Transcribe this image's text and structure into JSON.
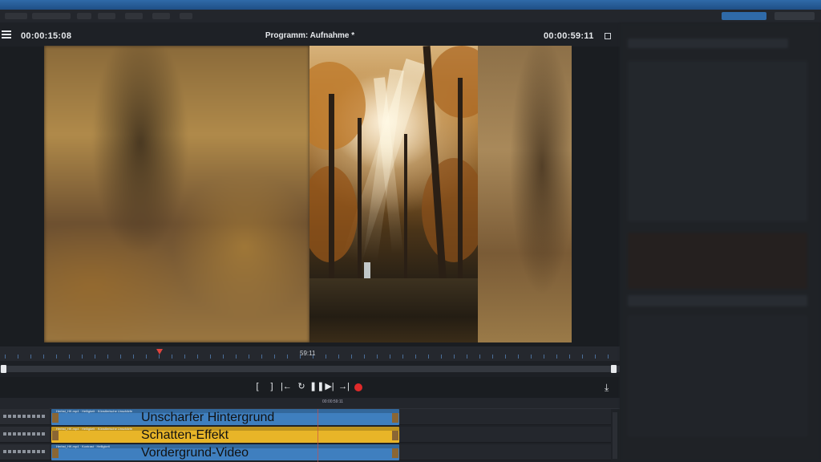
{
  "player": {
    "current_timecode": "00:00:15:08",
    "title": "Programm: Aufnahme *",
    "duration_timecode": "00:00:59:11"
  },
  "scrubber": {
    "ruler_timecode": "59:11"
  },
  "transport": {
    "mark_in": "[",
    "mark_out": "]",
    "go_to_start": "|←",
    "loop": "↻",
    "pause": "❚❚",
    "next_frame": "▶|",
    "go_to_end": "→|",
    "tool": "⤓"
  },
  "timeline": {
    "center_timecode": "00:00:59:11",
    "tracks": [
      {
        "clip_name": "Herbst_HK.mp4 · Helligkeit · Künstlerische Unschärfe",
        "label": "Unscharfer Hintergrund",
        "color": "#3f7fbf"
      },
      {
        "clip_name": "Herbst_HK.mp4 · Helligkeit · Künstlerische Unschärfe",
        "label": "Schatten-Effekt",
        "color": "#e8b528"
      },
      {
        "clip_name": "Herbst_HK.mp4 · Kontrast · Helligkeit",
        "label": "Vordergrund-Video",
        "color": "#3f7fbf"
      }
    ]
  },
  "colors": {
    "accent": "#2f6aa8",
    "record": "#e02a2a",
    "playhead": "#e0443e"
  },
  "icons": [
    "menu-icon",
    "maximize-icon",
    "record-icon",
    "tool-icon"
  ]
}
